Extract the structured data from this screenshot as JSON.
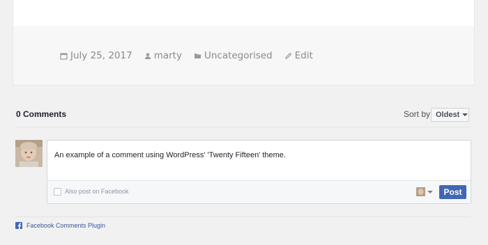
{
  "post_meta": {
    "date": "July 25, 2017",
    "author": "marty",
    "category": "Uncategorised",
    "edit": "Edit",
    "icons": [
      "calendar-icon",
      "user-icon",
      "folder-icon",
      "pencil-icon"
    ]
  },
  "comments": {
    "count_label": "0 Comments",
    "sort_label": "Sort by",
    "sort_selected": "Oldest"
  },
  "composer": {
    "text": "An example of a comment using WordPress' 'Twenty Fifteen' theme.",
    "facebook_checkbox_label": "Also post on Facebook",
    "post_button": "Post"
  },
  "plugin": {
    "link_label": "Facebook Comments Plugin"
  },
  "colors": {
    "facebook_blue": "#4267b2",
    "link_blue": "#365899",
    "page_bg": "#f1f1f1"
  }
}
